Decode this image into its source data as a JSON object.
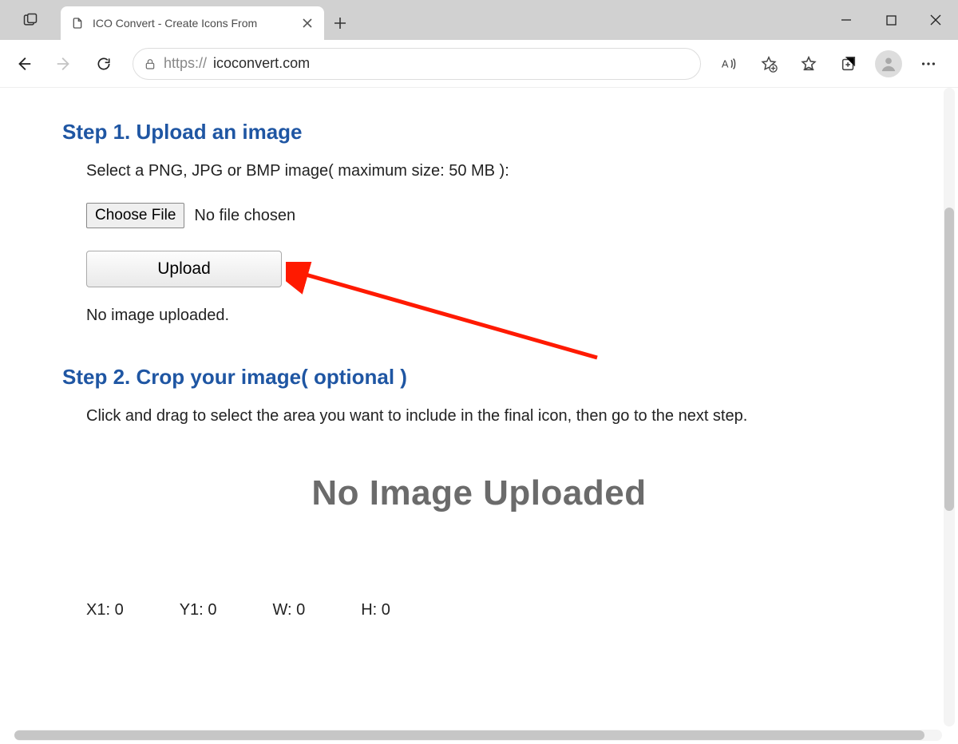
{
  "browser": {
    "tab_title": "ICO Convert - Create Icons From",
    "url_protocol": "https://",
    "url_host": "icoconvert.com"
  },
  "page": {
    "step1": {
      "heading": "Step 1. Upload an image",
      "instruction": "Select a PNG, JPG or BMP image( maximum size: 50 MB ):",
      "choose_button": "Choose File",
      "file_status": "No file chosen",
      "upload_button": "Upload",
      "upload_status": "No image uploaded."
    },
    "step2": {
      "heading": "Step 2. Crop your image( optional )",
      "instruction": "Click and drag to select the area you want to include in the final icon, then go to the next step.",
      "placeholder": "No Image Uploaded",
      "coords": {
        "x1_label": "X1:",
        "x1": "0",
        "y1_label": "Y1:",
        "y1": "0",
        "w_label": "W:",
        "w": "0",
        "h_label": "H:",
        "h": "0"
      }
    }
  }
}
